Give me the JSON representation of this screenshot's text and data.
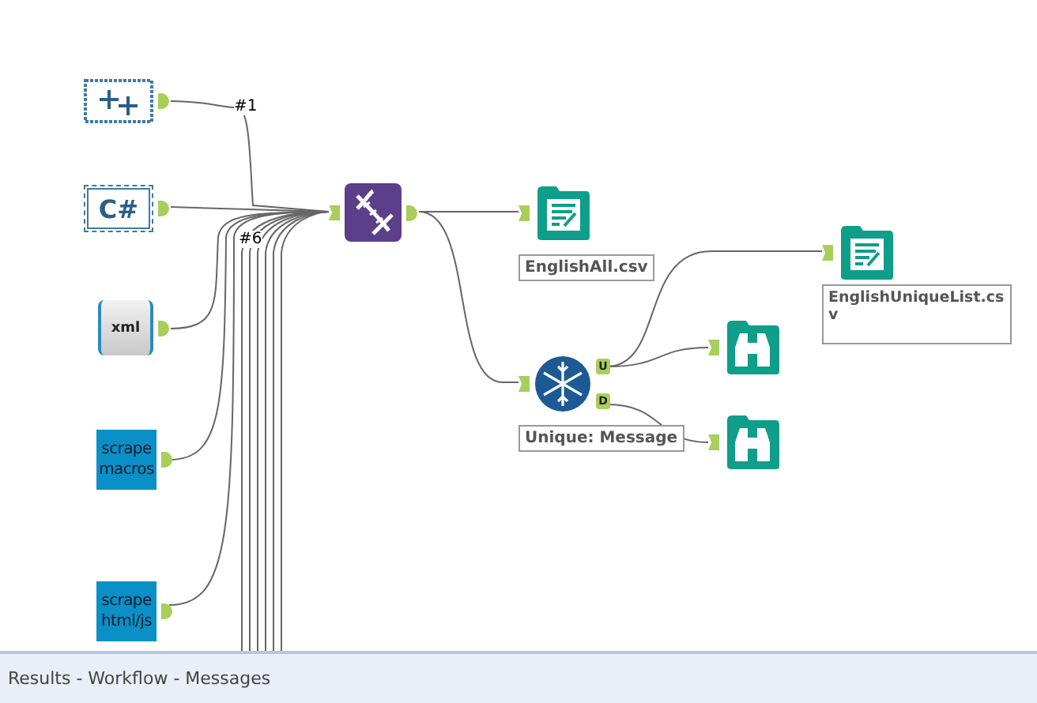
{
  "canvas": {
    "tools": [
      {
        "kind": "formula"
      },
      {
        "kind": "csharp",
        "icon_text": "C#"
      },
      {
        "kind": "xml",
        "icon_text": "xml"
      },
      {
        "kind": "macro",
        "label": "scrape macros"
      },
      {
        "kind": "macro",
        "label": "scrape html/js"
      },
      {
        "kind": "dna"
      },
      {
        "kind": "output",
        "annotation": "EnglishAll.csv"
      },
      {
        "kind": "unique",
        "annotation": "Unique: Message",
        "anchors": [
          "U",
          "D"
        ]
      },
      {
        "kind": "output",
        "annotation": "EnglishUniqueList.csv"
      },
      {
        "kind": "browse"
      },
      {
        "kind": "browse"
      }
    ],
    "wire_labels": [
      "#1",
      "#6"
    ]
  },
  "status_bar": {
    "text": "Results - Workflow - Messages"
  }
}
